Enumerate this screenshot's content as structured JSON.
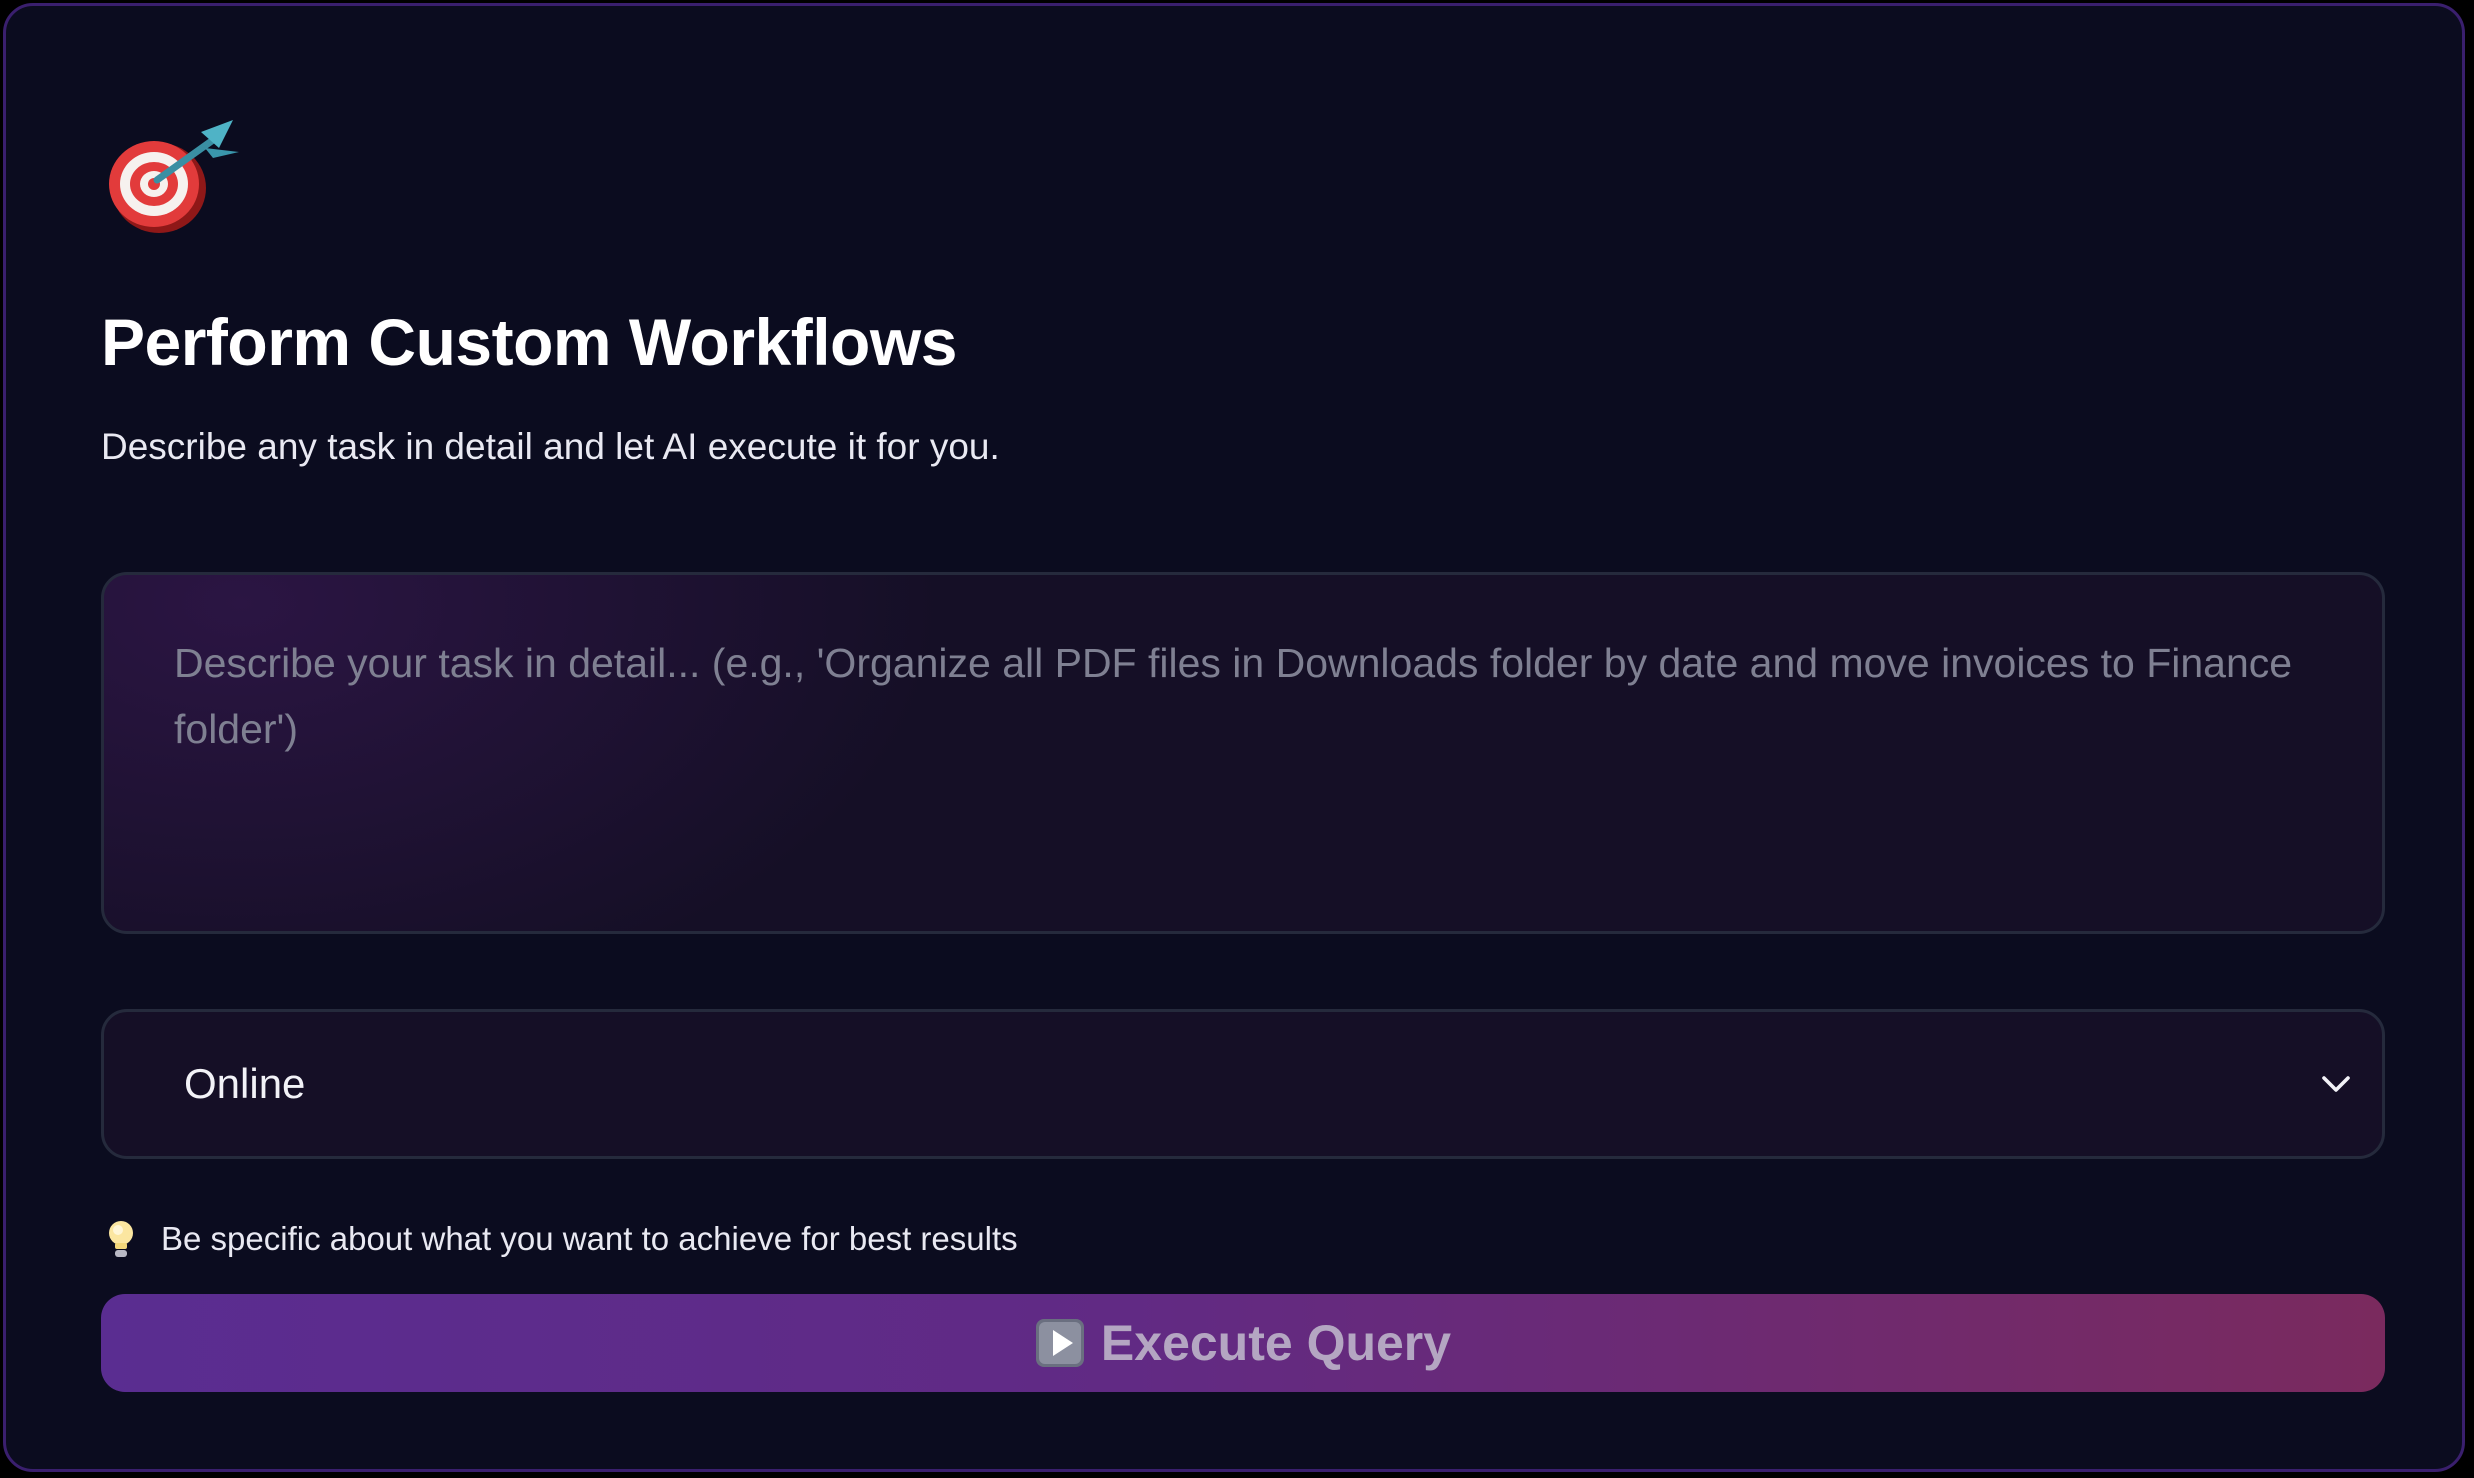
{
  "header": {
    "icon": "target-dart-icon",
    "title": "Perform Custom Workflows",
    "subtitle": "Describe any task in detail and let AI execute it for you."
  },
  "task_input": {
    "value": "",
    "placeholder": "Describe your task in detail... (e.g., 'Organize all PDF files in Downloads folder by date and move invoices to Finance folder')"
  },
  "mode_select": {
    "selected": "Online",
    "icon": "chevron-down-icon"
  },
  "tip": {
    "icon": "lightbulb-icon",
    "text": "Be specific about what you want to achieve for best results"
  },
  "execute_button": {
    "icon": "play-icon",
    "label": "Execute Query"
  },
  "colors": {
    "background": "#0b0c1f",
    "frame_border": "#3a1f6e",
    "button_gradient_start": "#5a2d91",
    "button_gradient_end": "#7a2a5e"
  }
}
